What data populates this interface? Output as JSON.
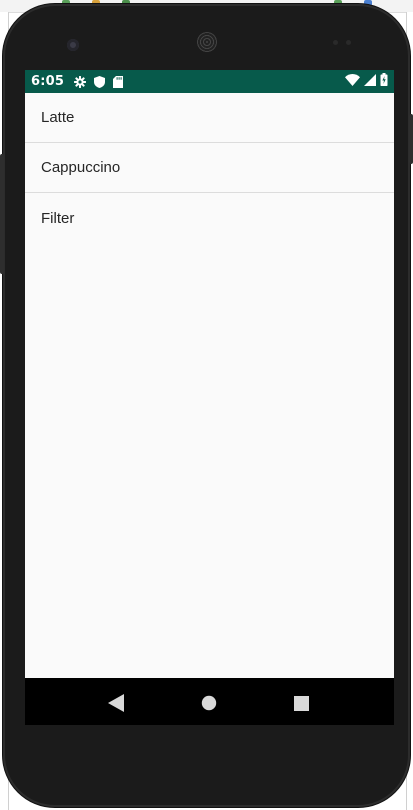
{
  "status_bar": {
    "time": "6:05",
    "left_icons": [
      "gear-icon",
      "shield-icon",
      "sd-card-icon"
    ],
    "right_icons": [
      "wifi-icon",
      "cell-signal-icon",
      "battery-charging-icon"
    ],
    "background": "#075a4b"
  },
  "list": {
    "items": [
      {
        "label": "Latte"
      },
      {
        "label": "Cappuccino"
      },
      {
        "label": "Filter"
      }
    ]
  },
  "nav_bar": {
    "buttons": [
      "back-icon",
      "home-icon",
      "recents-icon"
    ]
  }
}
